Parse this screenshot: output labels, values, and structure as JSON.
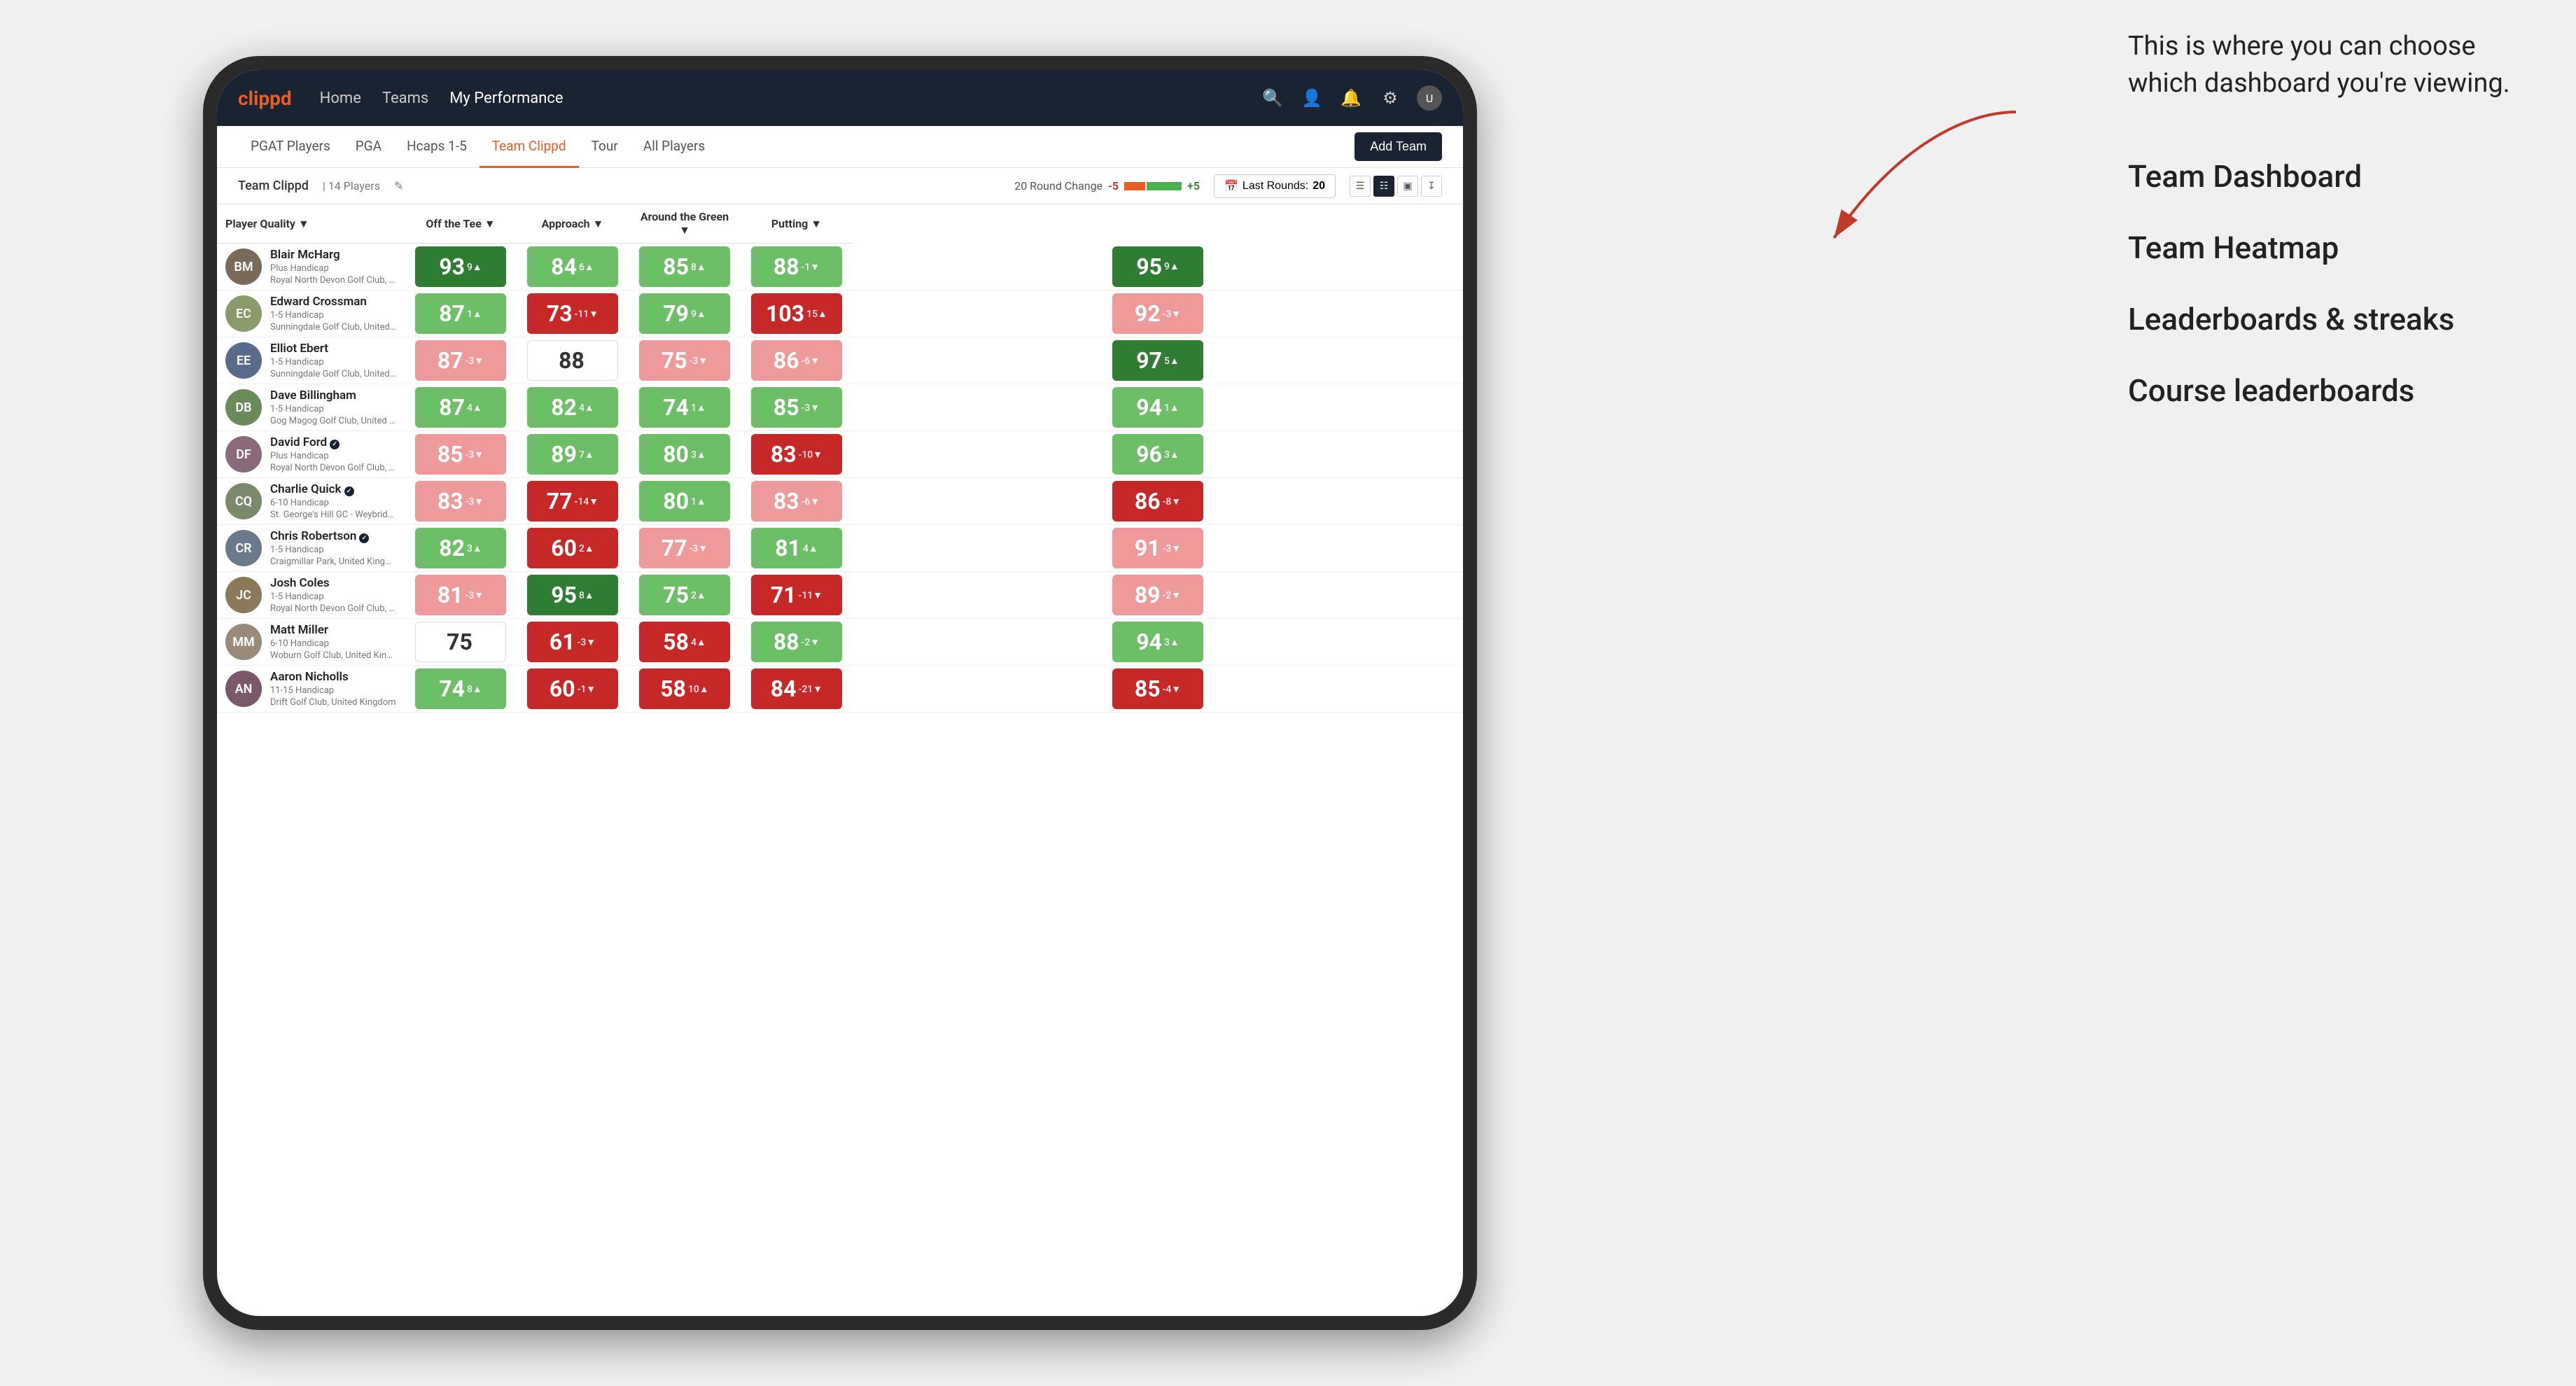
{
  "annotation": {
    "intro_text": "This is where you can choose which dashboard you're viewing.",
    "options": [
      "Team Dashboard",
      "Team Heatmap",
      "Leaderboards & streaks",
      "Course leaderboards"
    ]
  },
  "nav": {
    "logo": "clippd",
    "items": [
      "Home",
      "Teams",
      "My Performance"
    ],
    "active_item": "My Performance"
  },
  "sub_nav": {
    "items": [
      "PGAT Players",
      "PGA",
      "Hcaps 1-5",
      "Team Clippd",
      "Tour",
      "All Players"
    ],
    "active_item": "Team Clippd",
    "add_team_label": "Add Team"
  },
  "team_bar": {
    "team_name": "Team Clippd",
    "separator": "|",
    "player_count": "14 Players",
    "round_change_label": "20 Round Change",
    "change_neg": "-5",
    "change_pos": "+5",
    "last_rounds_label": "Last Rounds:",
    "last_rounds_value": "20"
  },
  "table": {
    "col_headers": [
      "Player Quality ▼",
      "Off the Tee ▼",
      "Approach ▼",
      "Around the Green ▼",
      "Putting ▼"
    ],
    "rows": [
      {
        "name": "Blair McHarg",
        "handicap": "Plus Handicap",
        "club": "Royal North Devon Golf Club, United Kingdom",
        "avatar_initials": "BM",
        "avatar_color": "#7a6a5a",
        "scores": [
          {
            "value": "93",
            "change": "9▲",
            "color": "green-dark"
          },
          {
            "value": "84",
            "change": "6▲",
            "color": "green-light"
          },
          {
            "value": "85",
            "change": "8▲",
            "color": "green-light"
          },
          {
            "value": "88",
            "change": "-1▼",
            "color": "green-light"
          },
          {
            "value": "95",
            "change": "9▲",
            "color": "green-dark"
          }
        ]
      },
      {
        "name": "Edward Crossman",
        "handicap": "1-5 Handicap",
        "club": "Sunningdale Golf Club, United Kingdom",
        "avatar_initials": "EC",
        "avatar_color": "#8a9a6a",
        "scores": [
          {
            "value": "87",
            "change": "1▲",
            "color": "green-light"
          },
          {
            "value": "73",
            "change": "-11▼",
            "color": "red-dark"
          },
          {
            "value": "79",
            "change": "9▲",
            "color": "green-light"
          },
          {
            "value": "103",
            "change": "15▲",
            "color": "red-dark"
          },
          {
            "value": "92",
            "change": "-3▼",
            "color": "red-light"
          }
        ]
      },
      {
        "name": "Elliot Ebert",
        "handicap": "1-5 Handicap",
        "club": "Sunningdale Golf Club, United Kingdom",
        "avatar_initials": "EE",
        "avatar_color": "#5a6a8a",
        "scores": [
          {
            "value": "87",
            "change": "-3▼",
            "color": "red-light"
          },
          {
            "value": "88",
            "change": "",
            "color": "neutral"
          },
          {
            "value": "75",
            "change": "-3▼",
            "color": "red-light"
          },
          {
            "value": "86",
            "change": "-6▼",
            "color": "red-light"
          },
          {
            "value": "97",
            "change": "5▲",
            "color": "green-dark"
          }
        ]
      },
      {
        "name": "Dave Billingham",
        "handicap": "1-5 Handicap",
        "club": "Gog Magog Golf Club, United Kingdom",
        "avatar_initials": "DB",
        "avatar_color": "#6a8a5a",
        "scores": [
          {
            "value": "87",
            "change": "4▲",
            "color": "green-light"
          },
          {
            "value": "82",
            "change": "4▲",
            "color": "green-light"
          },
          {
            "value": "74",
            "change": "1▲",
            "color": "green-light"
          },
          {
            "value": "85",
            "change": "-3▼",
            "color": "green-light"
          },
          {
            "value": "94",
            "change": "1▲",
            "color": "green-light"
          }
        ]
      },
      {
        "name": "David Ford",
        "handicap": "Plus Handicap",
        "club": "Royal North Devon Golf Club, United Kingdom",
        "avatar_initials": "DF",
        "avatar_color": "#8a6a7a",
        "verified": true,
        "scores": [
          {
            "value": "85",
            "change": "-3▼",
            "color": "red-light"
          },
          {
            "value": "89",
            "change": "7▲",
            "color": "green-light"
          },
          {
            "value": "80",
            "change": "3▲",
            "color": "green-light"
          },
          {
            "value": "83",
            "change": "-10▼",
            "color": "red-dark"
          },
          {
            "value": "96",
            "change": "3▲",
            "color": "green-light"
          }
        ]
      },
      {
        "name": "Charlie Quick",
        "handicap": "6-10 Handicap",
        "club": "St. George's Hill GC - Weybridge - Surrey, Uni...",
        "avatar_initials": "CQ",
        "avatar_color": "#7a8a6a",
        "verified": true,
        "scores": [
          {
            "value": "83",
            "change": "-3▼",
            "color": "red-light"
          },
          {
            "value": "77",
            "change": "-14▼",
            "color": "red-dark"
          },
          {
            "value": "80",
            "change": "1▲",
            "color": "green-light"
          },
          {
            "value": "83",
            "change": "-6▼",
            "color": "red-light"
          },
          {
            "value": "86",
            "change": "-8▼",
            "color": "red-dark"
          }
        ]
      },
      {
        "name": "Chris Robertson",
        "handicap": "1-5 Handicap",
        "club": "Craigmillar Park, United Kingdom",
        "avatar_initials": "CR",
        "avatar_color": "#6a7a8a",
        "verified": true,
        "scores": [
          {
            "value": "82",
            "change": "3▲",
            "color": "green-light"
          },
          {
            "value": "60",
            "change": "2▲",
            "color": "red-dark"
          },
          {
            "value": "77",
            "change": "-3▼",
            "color": "red-light"
          },
          {
            "value": "81",
            "change": "4▲",
            "color": "green-light"
          },
          {
            "value": "91",
            "change": "-3▼",
            "color": "red-light"
          }
        ]
      },
      {
        "name": "Josh Coles",
        "handicap": "1-5 Handicap",
        "club": "Royal North Devon Golf Club, United Kingdom",
        "avatar_initials": "JC",
        "avatar_color": "#8a7a5a",
        "scores": [
          {
            "value": "81",
            "change": "-3▼",
            "color": "red-light"
          },
          {
            "value": "95",
            "change": "8▲",
            "color": "green-dark"
          },
          {
            "value": "75",
            "change": "2▲",
            "color": "green-light"
          },
          {
            "value": "71",
            "change": "-11▼",
            "color": "red-dark"
          },
          {
            "value": "89",
            "change": "-2▼",
            "color": "red-light"
          }
        ]
      },
      {
        "name": "Matt Miller",
        "handicap": "6-10 Handicap",
        "club": "Woburn Golf Club, United Kingdom",
        "avatar_initials": "MM",
        "avatar_color": "#9a8a7a",
        "scores": [
          {
            "value": "75",
            "change": "",
            "color": "neutral"
          },
          {
            "value": "61",
            "change": "-3▼",
            "color": "red-dark"
          },
          {
            "value": "58",
            "change": "4▲",
            "color": "red-dark"
          },
          {
            "value": "88",
            "change": "-2▼",
            "color": "green-light"
          },
          {
            "value": "94",
            "change": "3▲",
            "color": "green-light"
          }
        ]
      },
      {
        "name": "Aaron Nicholls",
        "handicap": "11-15 Handicap",
        "club": "Drift Golf Club, United Kingdom",
        "avatar_initials": "AN",
        "avatar_color": "#7a5a6a",
        "scores": [
          {
            "value": "74",
            "change": "8▲",
            "color": "green-light"
          },
          {
            "value": "60",
            "change": "-1▼",
            "color": "red-dark"
          },
          {
            "value": "58",
            "change": "10▲",
            "color": "red-dark"
          },
          {
            "value": "84",
            "change": "-21▼",
            "color": "red-dark"
          },
          {
            "value": "85",
            "change": "-4▼",
            "color": "red-dark"
          }
        ]
      }
    ]
  },
  "colors": {
    "nav_bg": "#1a2332",
    "accent": "#e85d26",
    "green_dark": "#2e7d32",
    "green_light": "#81c784",
    "red_dark": "#c62828",
    "red_light": "#ef9a9a"
  }
}
